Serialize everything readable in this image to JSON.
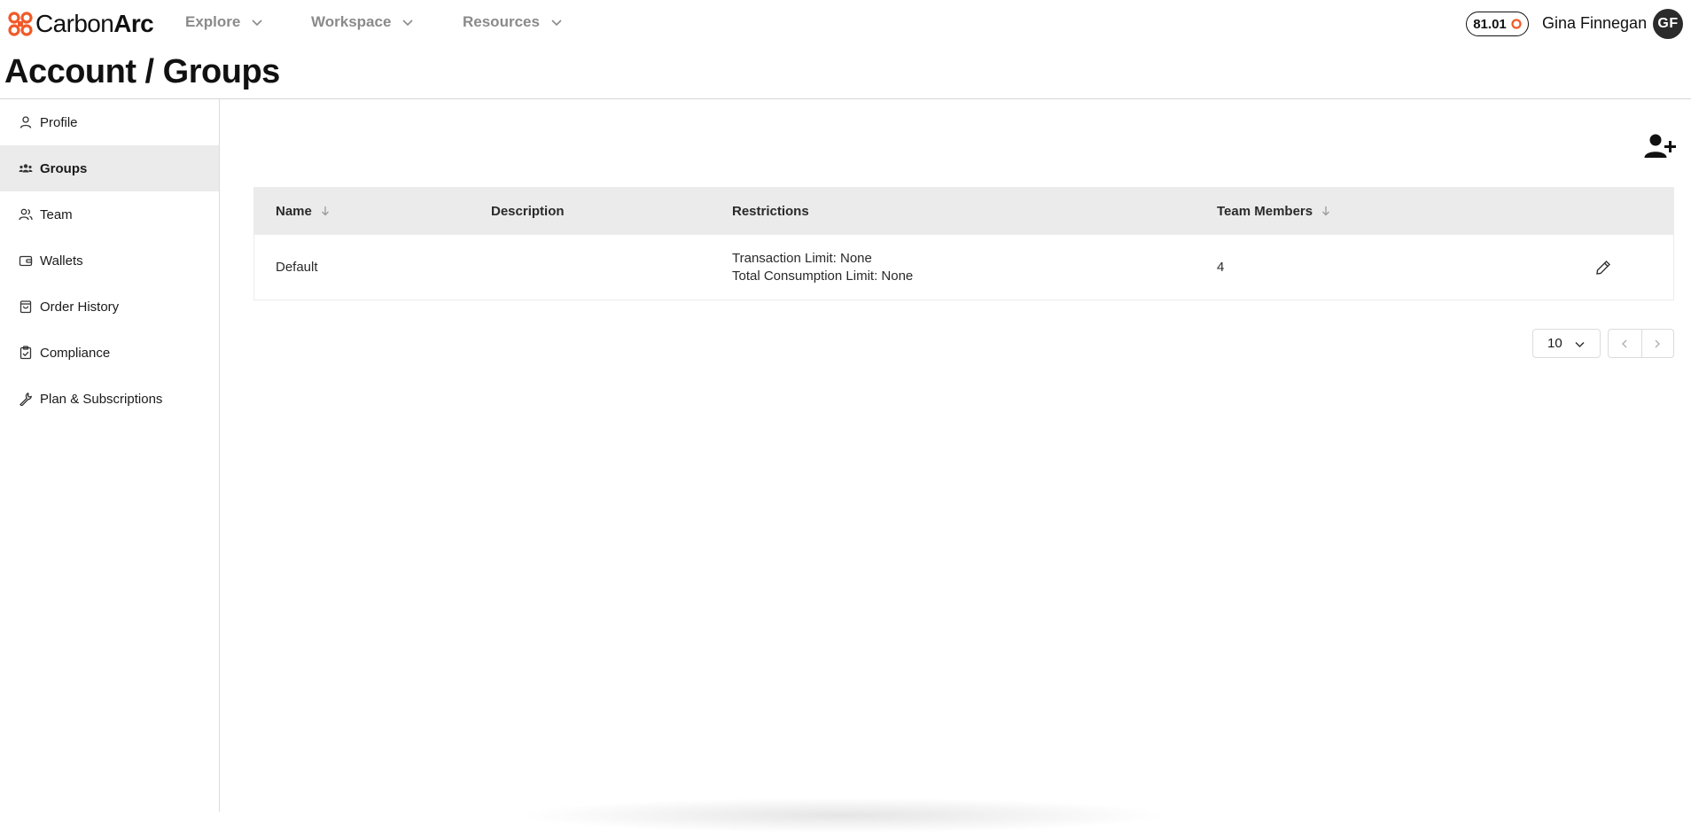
{
  "brand": {
    "name_light": "Carbon",
    "name_bold": "Arc",
    "accent_color": "#f05a28",
    "icon": "carbonarc-logo-icon"
  },
  "nav": {
    "items": [
      {
        "label": "Explore",
        "icon": "chevron-down-icon"
      },
      {
        "label": "Workspace",
        "icon": "chevron-down-icon"
      },
      {
        "label": "Resources",
        "icon": "chevron-down-icon"
      }
    ]
  },
  "user": {
    "credits": "81.01",
    "credit_icon": "coin-icon",
    "name": "Gina Finnegan",
    "initials": "GF"
  },
  "page": {
    "title": "Account / Groups"
  },
  "sidebar": {
    "items": [
      {
        "label": "Profile",
        "icon": "user-icon",
        "active": false
      },
      {
        "label": "Groups",
        "icon": "users-group-icon",
        "active": true
      },
      {
        "label": "Team",
        "icon": "team-icon",
        "active": false
      },
      {
        "label": "Wallets",
        "icon": "wallet-icon",
        "active": false
      },
      {
        "label": "Order History",
        "icon": "shopping-bag-icon",
        "active": false
      },
      {
        "label": "Compliance",
        "icon": "clipboard-check-icon",
        "active": false
      },
      {
        "label": "Plan & Subscriptions",
        "icon": "wrench-icon",
        "active": false
      }
    ]
  },
  "actions": {
    "add_group_icon": "user-plus-icon"
  },
  "table": {
    "columns": [
      {
        "label": "Name",
        "sortable": true
      },
      {
        "label": "Description",
        "sortable": false
      },
      {
        "label": "Restrictions",
        "sortable": false
      },
      {
        "label": "Team Members",
        "sortable": true
      }
    ],
    "rows": [
      {
        "name": "Default",
        "description": "",
        "restriction_1": "Transaction Limit: None",
        "restriction_2": "Total Consumption Limit: None",
        "team_members": "4",
        "action_icon": "pencil-icon"
      }
    ]
  },
  "pagination": {
    "page_size": "10",
    "prev_icon": "chevron-left-icon",
    "next_icon": "chevron-right-icon"
  }
}
